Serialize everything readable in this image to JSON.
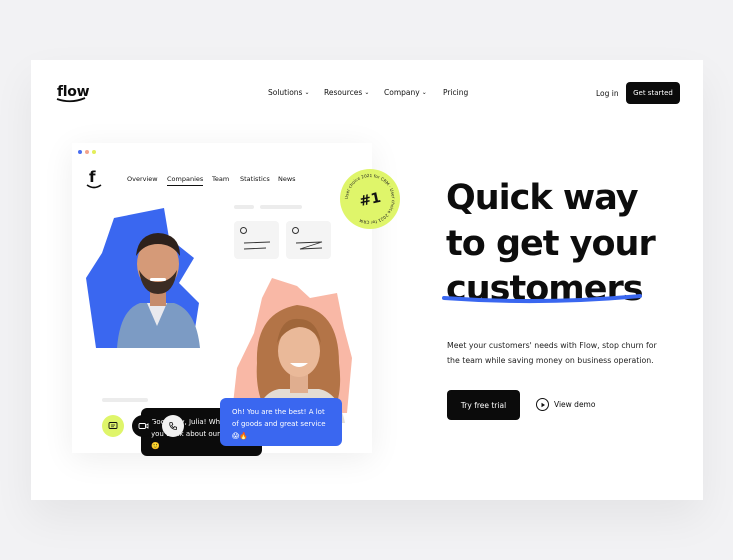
{
  "header": {
    "logo": "flow",
    "nav": [
      {
        "label": "Solutions",
        "has_menu": true
      },
      {
        "label": "Resources",
        "has_menu": true
      },
      {
        "label": "Company",
        "has_menu": true
      },
      {
        "label": "Pricing",
        "has_menu": false
      }
    ],
    "chevron": "⌄",
    "login": "Log in",
    "cta": "Get started"
  },
  "mock": {
    "logo": "f",
    "tabs": [
      "Overview",
      "Companies",
      "Team",
      "Statistics",
      "News"
    ],
    "active_tab": "Companies",
    "badge_number": "#1",
    "badge_ring_text": "User choice 2021 for CRM · User choice 2021 for CRM",
    "bubble_left": "Good day, Julia! What do you think about our store? 🙂",
    "bubble_right": "Oh! You are the best! A lot of goods and great service 😱🔥",
    "action_icons": [
      "chat-icon",
      "camera-icon",
      "phone-icon"
    ]
  },
  "hero": {
    "line1": "Quick way",
    "line2": "to get your",
    "line3": "customers",
    "subtext": "Meet your customers' needs with Flow, stop churn for the team while saving money on business operation.",
    "primary_cta": "Try free trial",
    "secondary_cta": "View demo"
  },
  "colors": {
    "accent_blue": "#3a67f0",
    "lime": "#dff56a",
    "peach": "#f9b8a6",
    "dark": "#0b0b0b"
  }
}
